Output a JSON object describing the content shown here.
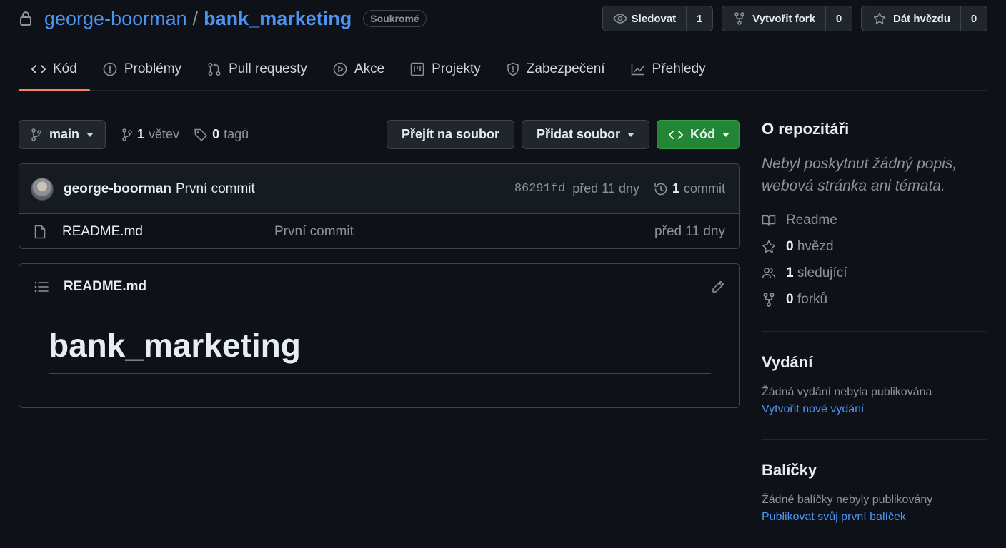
{
  "header": {
    "owner": "george-boorman",
    "separator": "/",
    "repo": "bank_marketing",
    "visibility": "Soukromé",
    "watch": {
      "label": "Sledovat",
      "count": "1"
    },
    "fork": {
      "label": "Vytvořit fork",
      "count": "0"
    },
    "star": {
      "label": "Dát hvězdu",
      "count": "0"
    }
  },
  "nav": {
    "items": [
      {
        "label": "Kód",
        "icon": "code-icon"
      },
      {
        "label": "Problémy",
        "icon": "issue-icon"
      },
      {
        "label": "Pull requesty",
        "icon": "pull-request-icon"
      },
      {
        "label": "Akce",
        "icon": "play-icon"
      },
      {
        "label": "Projekty",
        "icon": "project-icon"
      },
      {
        "label": "Zabezpečení",
        "icon": "shield-icon"
      },
      {
        "label": "Přehledy",
        "icon": "graph-icon"
      }
    ]
  },
  "toolbar": {
    "branch": "main",
    "branches_count": "1",
    "branches_label": "větev",
    "tags_count": "0",
    "tags_label": "tagů",
    "goto_file": "Přejít na soubor",
    "add_file": "Přidat soubor",
    "code": "Kód"
  },
  "commit": {
    "author": "george-boorman",
    "message": "První commit",
    "sha": "86291fd",
    "date": "před 11 dny",
    "count": "1",
    "count_label": "commit"
  },
  "files": [
    {
      "name": "README.md",
      "commit": "První commit",
      "date": "před 11 dny"
    }
  ],
  "readme": {
    "filename": "README.md",
    "heading": "bank_marketing"
  },
  "sidebar": {
    "about_title": "O repozitáři",
    "description": "Nebyl poskytnut žádný popis, webová stránka ani témata.",
    "readme": "Readme",
    "stars_count": "0",
    "stars_label": "hvězd",
    "watchers_count": "1",
    "watchers_label": "sledující",
    "forks_count": "0",
    "forks_label": "forků",
    "releases_title": "Vydání",
    "releases_text": "Žádná vydání nebyla publikována",
    "releases_link": "Vytvořit nové vydání",
    "packages_title": "Balíčky",
    "packages_text": "Žádné balíčky nebyly publikovány",
    "packages_link": "Publikovat svůj první balíček"
  },
  "colors": {
    "background": "#0e1117",
    "link": "#4d94f0",
    "accent_underline": "#f78166",
    "primary_button": "#238636"
  }
}
